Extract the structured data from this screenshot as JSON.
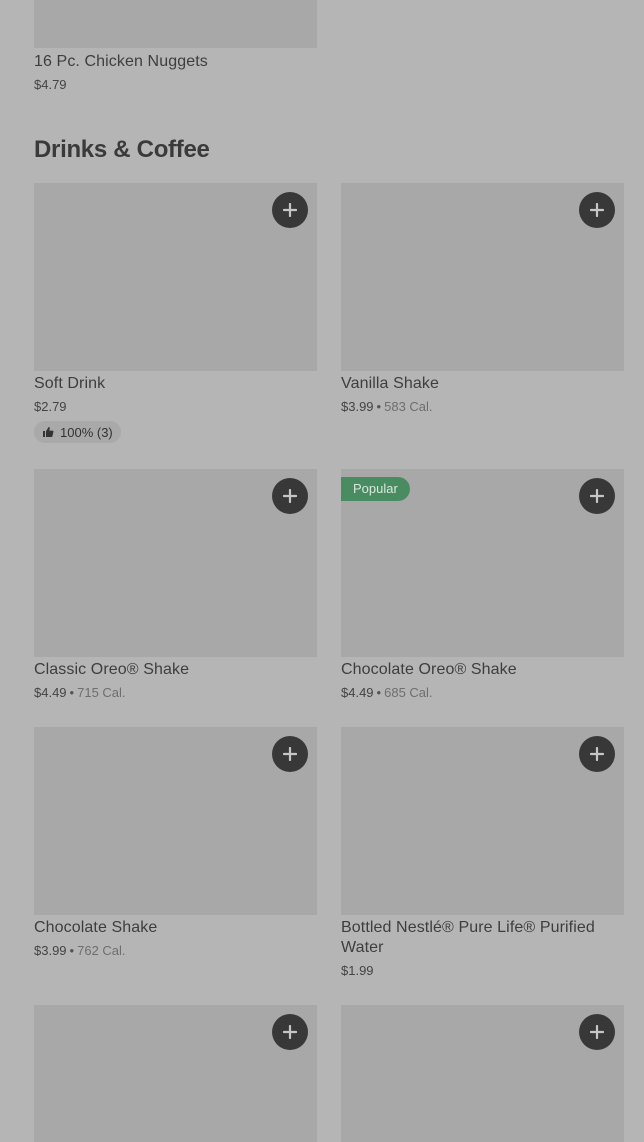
{
  "previous_item": {
    "name": "16 Pc. Chicken Nuggets",
    "price": "$4.79"
  },
  "section": {
    "title": "Drinks & Coffee"
  },
  "items": [
    {
      "name": "Soft Drink",
      "price": "$2.79",
      "rating": "100% (3)"
    },
    {
      "name": "Vanilla Shake",
      "price": "$3.99",
      "calories": "583 Cal."
    },
    {
      "name": "Classic Oreo® Shake",
      "price": "$4.49",
      "calories": "715 Cal."
    },
    {
      "name": "Chocolate Oreo® Shake",
      "price": "$4.49",
      "calories": "685 Cal.",
      "badge": "Popular"
    },
    {
      "name": "Chocolate Shake",
      "price": "$3.99",
      "calories": "762 Cal."
    },
    {
      "name": "Bottled Nestlé® Pure Life® Purified Water",
      "price": "$1.99"
    }
  ],
  "separator": "•",
  "icons": {
    "add": "plus-icon",
    "rating": "thumbs-up-icon"
  },
  "colors": {
    "background": "#b5b5b5",
    "image_placeholder": "#a8a8a8",
    "add_button": "#2f2f2f",
    "popular_badge": "#4a8c62"
  }
}
